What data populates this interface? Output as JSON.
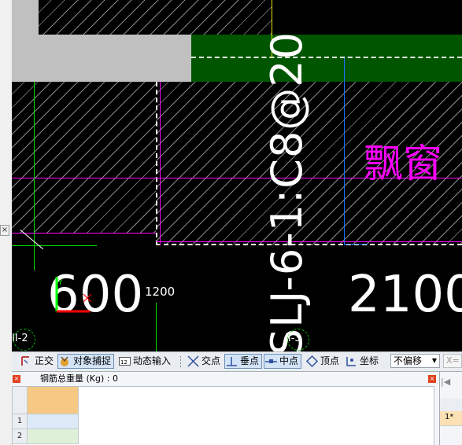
{
  "canvas": {
    "dimensions": [
      "600",
      "1200",
      "2100"
    ],
    "rebar_label": "SLJ-6-1:C8@20",
    "window_label": "飘窗",
    "axis_labels": [
      "II-2",
      "II-3"
    ]
  },
  "toolbar": {
    "items": [
      {
        "label": "正交",
        "icon": "ortho-icon",
        "active": false
      },
      {
        "label": "对象捕捉",
        "icon": "object-snap-icon",
        "active": true
      },
      {
        "label": "动态输入",
        "icon": "dynamic-input-icon",
        "active": false
      },
      {
        "label": "交点",
        "icon": "intersection-icon",
        "active": false
      },
      {
        "label": "垂点",
        "icon": "perpendicular-icon",
        "active": true
      },
      {
        "label": "中点",
        "icon": "midpoint-icon",
        "active": true
      },
      {
        "label": "顶点",
        "icon": "vertex-icon",
        "active": false
      },
      {
        "label": "坐标",
        "icon": "coordinate-icon",
        "active": false
      }
    ],
    "offset_select": "不偏移",
    "trailing_label": "X="
  },
  "rebar_panel": {
    "total_weight": "钢筋总重量 (Kg) : 0",
    "rows": [
      "1",
      "2"
    ]
  },
  "right_panel": {
    "row_label": "1*"
  },
  "colors": {
    "hatch": "#8a8a8a",
    "green_band": "#005500",
    "magenta": "#ff00ff",
    "blue_line": "#1e6fff",
    "snap_green": "#00ff00"
  }
}
